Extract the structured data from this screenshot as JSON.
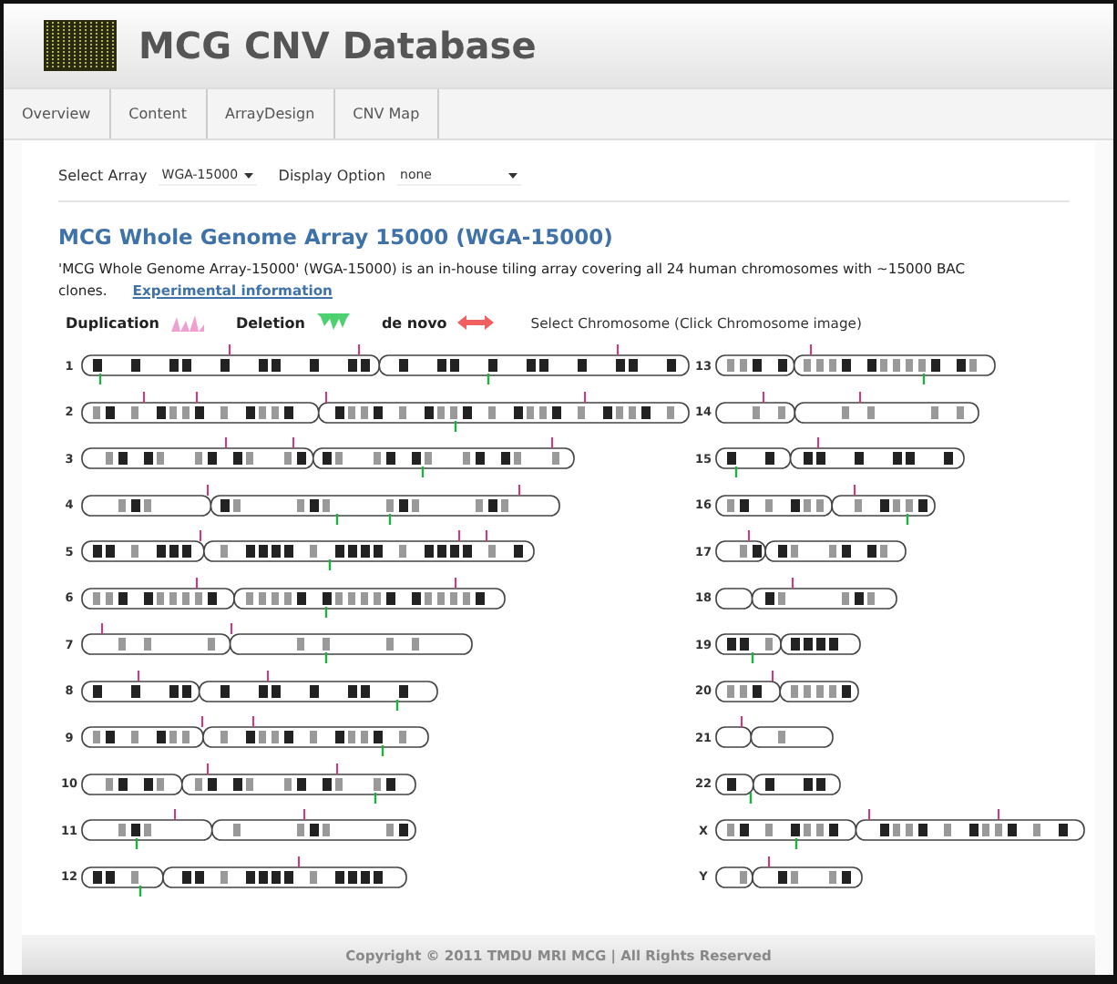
{
  "header": {
    "title": "MCG CNV Database"
  },
  "tabs": [
    {
      "label": "Overview"
    },
    {
      "label": "Content"
    },
    {
      "label": "ArrayDesign"
    },
    {
      "label": "CNV Map"
    }
  ],
  "controls": {
    "select_array": {
      "label": "Select Array",
      "value": "WGA-15000"
    },
    "display_option": {
      "label": "Display Option",
      "value": "none"
    }
  },
  "array_title": "MCG Whole Genome Array 15000 (WGA-15000)",
  "description": "'MCG Whole Genome Array-15000' (WGA-15000) is an in-house tiling array covering all 24 human chromosomes with ~15000 BAC clones.",
  "description_link": "Experimental information",
  "legend": [
    {
      "kind": "duplication",
      "label": "Duplication"
    },
    {
      "kind": "deletion",
      "label": "Deletion"
    },
    {
      "kind": "denovo",
      "label": "de novo"
    }
  ],
  "legend_note": "Select Chromosome (Click Chromosome image)",
  "chromosomes_left": [
    {
      "label": "1"
    },
    {
      "label": "2"
    },
    {
      "label": "3"
    },
    {
      "label": "4"
    },
    {
      "label": "5"
    },
    {
      "label": "6"
    },
    {
      "label": "7"
    },
    {
      "label": "8"
    },
    {
      "label": "9"
    },
    {
      "label": "10"
    },
    {
      "label": "11"
    },
    {
      "label": "12"
    }
  ],
  "chromosomes_right": [
    {
      "label": "13"
    },
    {
      "label": "14"
    },
    {
      "label": "15"
    },
    {
      "label": "16"
    },
    {
      "label": "17"
    },
    {
      "label": "18"
    },
    {
      "label": "19"
    },
    {
      "label": "20"
    },
    {
      "label": "21"
    },
    {
      "label": "22"
    },
    {
      "label": "X"
    },
    {
      "label": "Y"
    }
  ],
  "footer": "Copyright © 2011 TMDU MRI MCG | All Rights Reserved"
}
